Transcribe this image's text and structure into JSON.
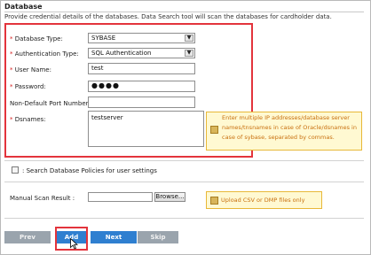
{
  "section": {
    "title": "Database",
    "description": "Provide credential details of the databases. Data Search tool will scan the databases for cardholder data."
  },
  "form": {
    "database_type": {
      "label": "Database Type:",
      "value": "SYBASE"
    },
    "auth_type": {
      "label": "Authentication Type:",
      "value": "SQL Authentication"
    },
    "user_name": {
      "label": "User Name:",
      "value": "test"
    },
    "password": {
      "label": "Password:",
      "value": "●●●●"
    },
    "port": {
      "label": "Non-Default Port Number:",
      "value": ""
    },
    "dsnames": {
      "label": "Dsnames:",
      "value": "testserver"
    },
    "required_marker": "*"
  },
  "dsn_hint": {
    "text_line1": "Enter multiple IP addresses/database server",
    "text_line2": "names/tnsnames in case of Oracle/dsnames in",
    "text_line3": "case of sybase, separated by commas."
  },
  "search_policies": {
    "label": ": Search Database Policies for user settings",
    "checked": false
  },
  "manual_scan": {
    "label": "Manual Scan Result :",
    "file_value": "",
    "browse_label": "Browse..."
  },
  "upload_hint": {
    "text": "Upload CSV or DMP files only"
  },
  "nav": {
    "prev": "Prev",
    "add": "Add",
    "next": "Next",
    "skip": "Skip"
  },
  "colors": {
    "highlight": "#e3343c",
    "primary_button": "#2f7fd0",
    "secondary_button": "#9aa4ad",
    "hint_bg": "#fff9d2",
    "hint_text": "#c8700f"
  }
}
